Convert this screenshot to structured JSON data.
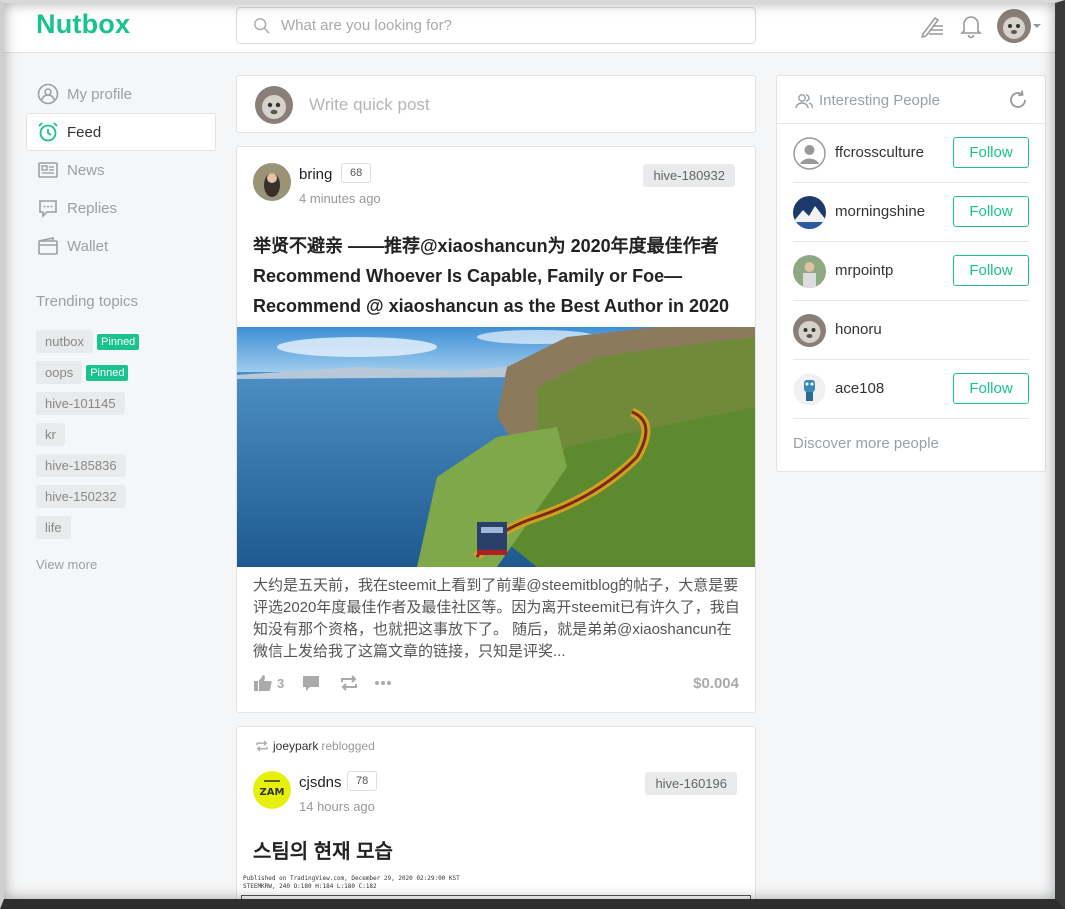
{
  "app": {
    "logo": "Nutbox",
    "accent": "#19c28f"
  },
  "search": {
    "placeholder": "What are you looking for?"
  },
  "nav": [
    {
      "label": "My profile",
      "icon": "user-circle-icon"
    },
    {
      "label": "Feed",
      "icon": "alarm-clock-icon",
      "active": true
    },
    {
      "label": "News",
      "icon": "newspaper-icon"
    },
    {
      "label": "Replies",
      "icon": "chat-bubble-icon"
    },
    {
      "label": "Wallet",
      "icon": "wallet-icon"
    }
  ],
  "trending": {
    "title": "Trending topics",
    "tags": [
      {
        "label": "nutbox",
        "badge": "Pinned"
      },
      {
        "label": "oops",
        "badge": "Pinned"
      },
      {
        "label": "hive-101145"
      },
      {
        "label": "kr"
      },
      {
        "label": "hive-185836"
      },
      {
        "label": "hive-150232"
      },
      {
        "label": "life"
      }
    ],
    "view_more": "View more"
  },
  "quick_post": {
    "placeholder": "Write quick post"
  },
  "post1": {
    "author": "bring",
    "reputation": "68",
    "time": "4 minutes ago",
    "community": "hive-180932",
    "title": "举贤不避亲 ——推荐@xiaoshancun为 2020年度最佳作者 Recommend Whoever Is Capable, Family or Foe—Recommend @ xiaoshancun as the Best Author in 2020",
    "excerpt": "大约是五天前，我在steemit上看到了前辈@steemitblog的帖子，大意是要评选2020年度最佳作者及最佳社区等。因为离开steemit已有许久了，我自知没有那个资格，也就把这事放下了。 随后，就是弟弟@xiaoshancun在微信上发给我了这篇文章的链接，只知是评奖...",
    "likes": "3",
    "payout": "$0.004"
  },
  "post2": {
    "reblogger": "joeypark",
    "reblog_text": "reblogged",
    "author": "cjsdns",
    "reputation": "78",
    "time": "14 hours ago",
    "community": "hive-160196",
    "title": "스팀의 현재 모습",
    "chart_caption_1": "Published on TradingView.com, December 29, 2020 02:29:00 KST",
    "chart_caption_2": "STEEMKRW, 240 O:180 H:184 L:180 C:182"
  },
  "people": {
    "title": "Interesting People",
    "items": [
      {
        "name": "ffcrossculture",
        "follow": "Follow"
      },
      {
        "name": "morningshine",
        "follow": "Follow"
      },
      {
        "name": "mrpointp",
        "follow": "Follow"
      },
      {
        "name": "honoru",
        "follow": ""
      },
      {
        "name": "ace108",
        "follow": "Follow"
      }
    ],
    "discover": "Discover more people"
  }
}
